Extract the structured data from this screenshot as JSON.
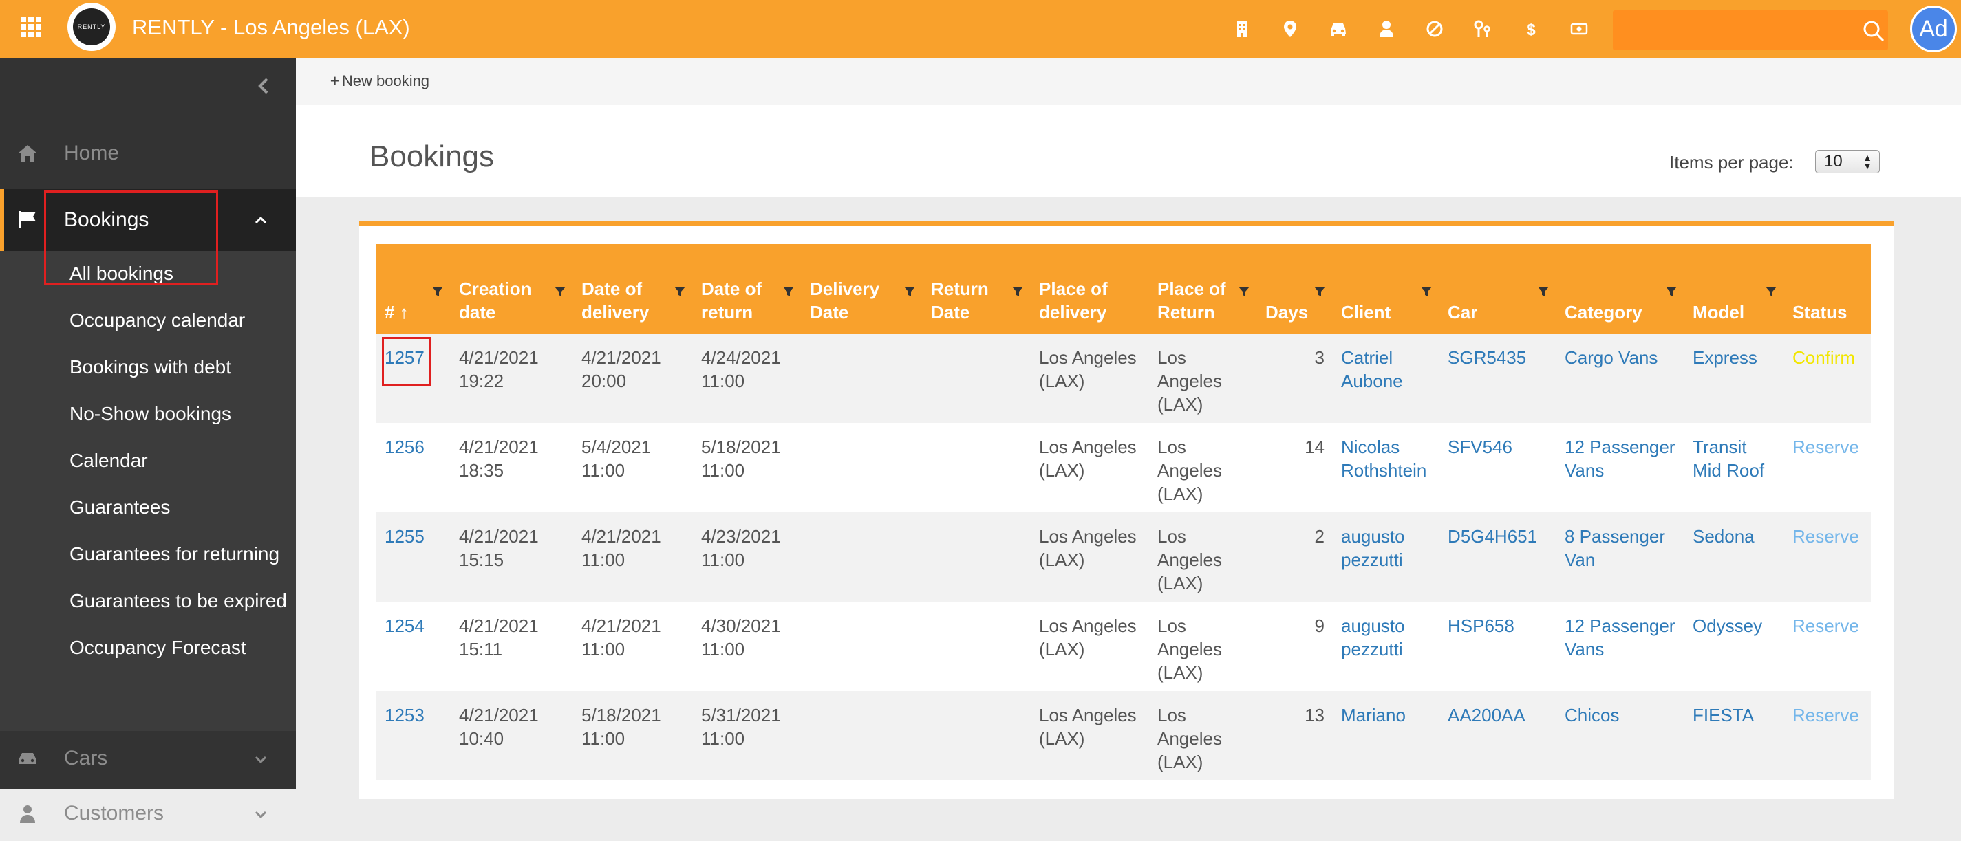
{
  "header": {
    "app_title": "RENTLY - Los Angeles (LAX)",
    "logo_text": "RENTLY",
    "avatar_initials": "Ad",
    "search_placeholder": "",
    "icons": [
      "building-icon",
      "map-pin-icon",
      "car-icon",
      "user-icon",
      "ban-icon",
      "keys-icon",
      "dollar-icon",
      "cash-icon"
    ]
  },
  "sidebar": {
    "items": [
      {
        "label": "Home",
        "icon": "home-icon"
      },
      {
        "label": "Bookings",
        "icon": "flag-icon"
      },
      {
        "label": "Cars",
        "icon": "car-icon"
      },
      {
        "label": "Customers",
        "icon": "user-icon"
      }
    ],
    "submenu": [
      "All bookings",
      "Occupancy calendar",
      "Bookings with debt",
      "No-Show bookings",
      "Calendar",
      "Guarantees",
      "Guarantees for returning",
      "Guarantees to be expired",
      "Occupancy Forecast"
    ]
  },
  "main": {
    "new_booking_label": "New booking",
    "page_title": "Bookings",
    "items_per_page_label": "Items per page:",
    "items_per_page_value": "10"
  },
  "table": {
    "headers": [
      {
        "label": "# ↑"
      },
      {
        "label": "Creation date"
      },
      {
        "label": "Date of delivery"
      },
      {
        "label": "Date of return"
      },
      {
        "label": "Delivery Date"
      },
      {
        "label": "Return Date"
      },
      {
        "label": "Place of delivery"
      },
      {
        "label": "Place of Return"
      },
      {
        "label": "Days"
      },
      {
        "label": "Client"
      },
      {
        "label": "Car"
      },
      {
        "label": "Category"
      },
      {
        "label": "Model"
      },
      {
        "label": "Status"
      }
    ],
    "rows": [
      {
        "id": "1257",
        "creation": "4/21/2021 19:22",
        "delivery": "4/21/2021 20:00",
        "return": "4/24/2021 11:00",
        "delivery_date": "",
        "return_date": "",
        "place_delivery": "Los Angeles (LAX)",
        "place_return": "Los Angeles (LAX)",
        "days": "3",
        "client": "Catriel Aubone",
        "car": "SGR5435",
        "category": "Cargo Vans",
        "model": "Express",
        "status": "Confirm",
        "status_type": "confirmed"
      },
      {
        "id": "1256",
        "creation": "4/21/2021 18:35",
        "delivery": "5/4/2021 11:00",
        "return": "5/18/2021 11:00",
        "delivery_date": "",
        "return_date": "",
        "place_delivery": "Los Angeles (LAX)",
        "place_return": "Los Angeles (LAX)",
        "days": "14",
        "client": "Nicolas Rothshtein",
        "car": "SFV546",
        "category": "12 Passenger Vans",
        "model": "Transit Mid Roof",
        "status": "Reserve",
        "status_type": "reserved"
      },
      {
        "id": "1255",
        "creation": "4/21/2021 15:15",
        "delivery": "4/21/2021 11:00",
        "return": "4/23/2021 11:00",
        "delivery_date": "",
        "return_date": "",
        "place_delivery": "Los Angeles (LAX)",
        "place_return": "Los Angeles (LAX)",
        "days": "2",
        "client": "augusto pezzutti",
        "car": "D5G4H651",
        "category": "8 Passenger Van",
        "model": "Sedona",
        "status": "Reserve",
        "status_type": "reserved"
      },
      {
        "id": "1254",
        "creation": "4/21/2021 15:11",
        "delivery": "4/21/2021 11:00",
        "return": "4/30/2021 11:00",
        "delivery_date": "",
        "return_date": "",
        "place_delivery": "Los Angeles (LAX)",
        "place_return": "Los Angeles (LAX)",
        "days": "9",
        "client": "augusto pezzutti",
        "car": "HSP658",
        "category": "12 Passenger Vans",
        "model": "Odyssey",
        "status": "Reserve",
        "status_type": "reserved"
      },
      {
        "id": "1253",
        "creation": "4/21/2021 10:40",
        "delivery": "5/18/2021 11:00",
        "return": "5/31/2021 11:00",
        "delivery_date": "",
        "return_date": "",
        "place_delivery": "Los Angeles (LAX)",
        "place_return": "Los Angeles (LAX)",
        "days": "13",
        "client": "Mariano",
        "car": "AA200AA",
        "category": "Chicos",
        "model": "FIESTA",
        "status": "Reserve",
        "status_type": "reserved"
      }
    ]
  },
  "colors": {
    "brand_orange": "#f9a12c",
    "sidebar_dark": "#333333",
    "link_blue": "#2e7ab8",
    "status_confirmed": "#f2e600",
    "status_reserved": "#74b6ea",
    "highlight_red": "#e02020"
  }
}
